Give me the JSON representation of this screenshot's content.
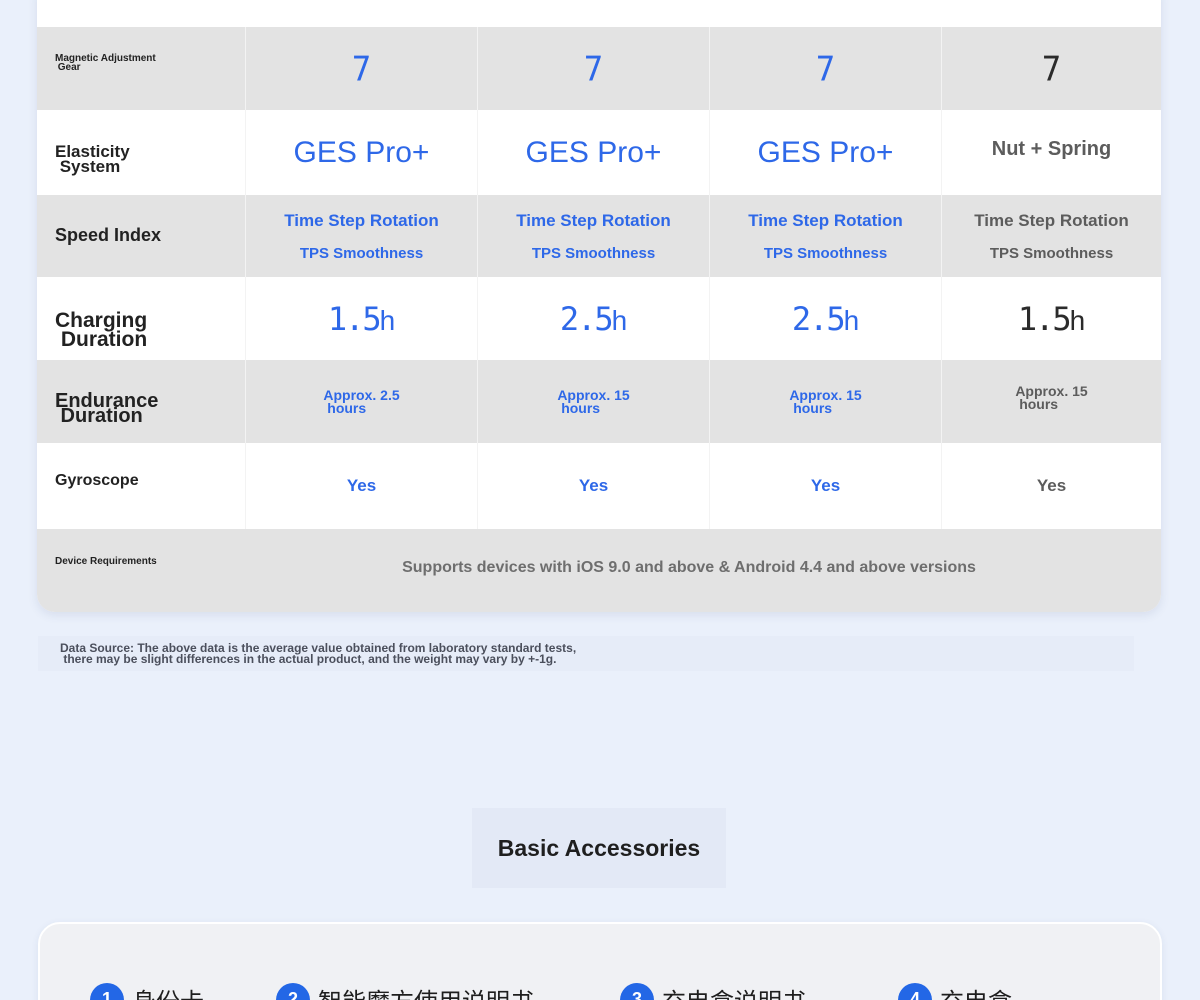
{
  "spec_table": {
    "rows": [
      {
        "label_lines": [
          "Magnetic Adjustment",
          " Gear"
        ],
        "values": [
          "7",
          "7",
          "7",
          "7"
        ]
      },
      {
        "label_lines": [
          "Elasticity",
          " System"
        ],
        "values": [
          "GES Pro+",
          "GES Pro+",
          "GES Pro+",
          "Nut + Spring"
        ]
      },
      {
        "label_lines": [
          "Speed Index"
        ],
        "values": [
          {
            "line1": "Time Step Rotation",
            "line2": "TPS Smoothness"
          },
          {
            "line1": "Time Step Rotation",
            "line2": "TPS Smoothness"
          },
          {
            "line1": "Time Step Rotation",
            "line2": "TPS Smoothness"
          },
          {
            "line1": "Time Step Rotation",
            "line2": "TPS Smoothness"
          }
        ]
      },
      {
        "label_lines": [
          "Charging",
          " Duration"
        ],
        "values": [
          {
            "num": "1.5",
            "unit": "h"
          },
          {
            "num": "2.5",
            "unit": "h"
          },
          {
            "num": "2.5",
            "unit": "h"
          },
          {
            "num": "1.5",
            "unit": "h"
          }
        ]
      },
      {
        "label_lines": [
          "Endurance",
          " Duration"
        ],
        "values": [
          {
            "line1": "Approx. 2.5",
            "line2": " hours"
          },
          {
            "line1": "Approx. 15",
            "line2": " hours"
          },
          {
            "line1": "Approx. 15",
            "line2": " hours"
          },
          {
            "line1": "Approx. 15",
            "line2": " hours"
          }
        ]
      },
      {
        "label_lines": [
          "Gyroscope"
        ],
        "values": [
          "Yes",
          "Yes",
          "Yes",
          "Yes"
        ]
      },
      {
        "label_lines": [
          "Device Requirements"
        ],
        "value": "Supports devices with iOS 9.0 and above & Android 4.4 and above versions"
      }
    ]
  },
  "footnote": {
    "line1": "Data Source: The above data is the average value obtained from laboratory standard tests,",
    "line2": " there may be slight differences in the actual product, and the weight may vary by +-1g."
  },
  "accessories": {
    "title": "Basic Accessories",
    "items": [
      {
        "num": "1",
        "label": "身份卡"
      },
      {
        "num": "2",
        "label": "智能魔方使用说明书"
      },
      {
        "num": "3",
        "label": "充电盒说明书"
      },
      {
        "num": "4",
        "label": "充电盒"
      }
    ]
  },
  "colors": {
    "accent_blue": "#2e68e8",
    "dark_value": "#2b2b2b",
    "page_bg": "#eaf0fb"
  }
}
